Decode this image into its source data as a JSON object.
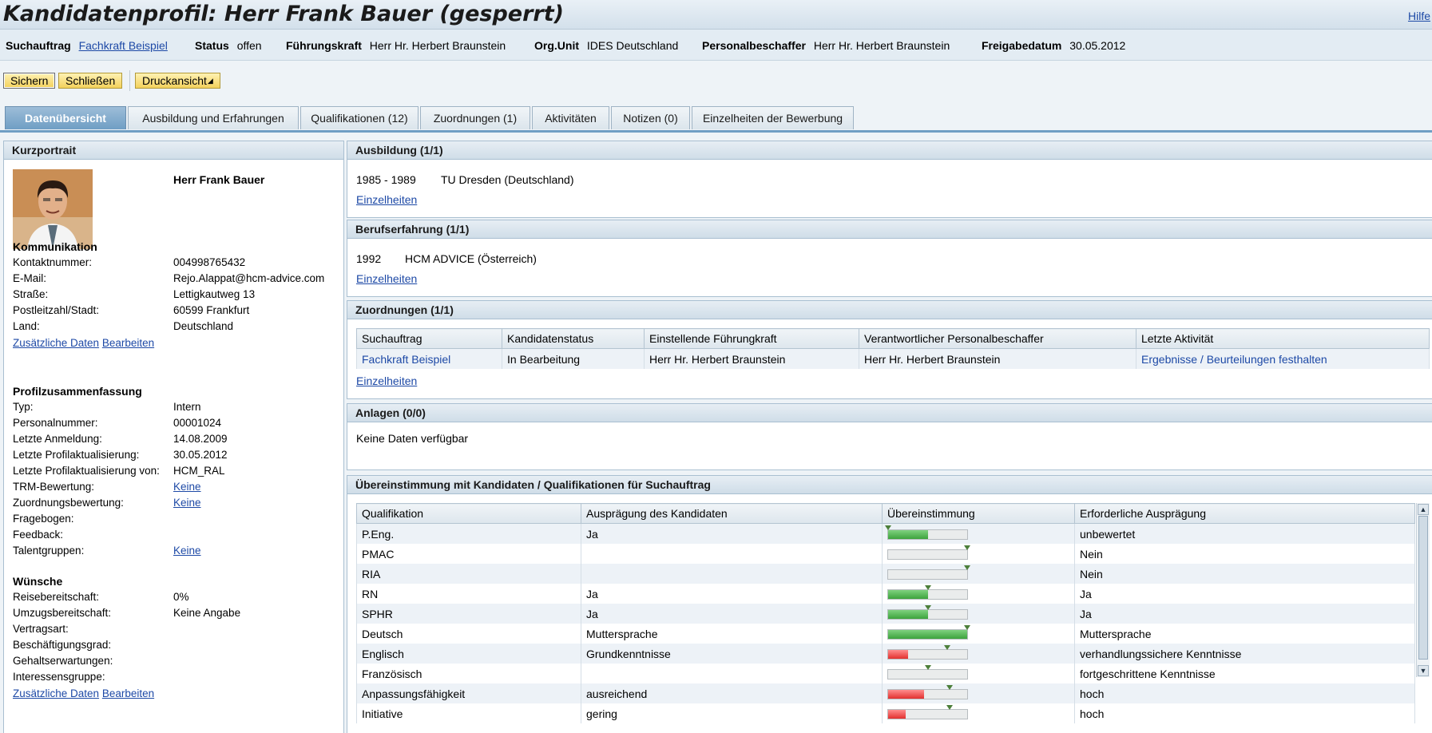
{
  "title": "Kandidatenprofil: Herr Frank Bauer (gesperrt)",
  "help_link": "Hilfe",
  "header": {
    "search_label": "Suchauftrag",
    "search_value": "Fachkraft Beispiel",
    "status_label": "Status",
    "status_value": "offen",
    "manager_label": "Führungskraft",
    "manager_value": "Herr Hr. Herbert Braunstein",
    "orgunit_label": "Org.Unit",
    "orgunit_value": "IDES Deutschland",
    "recruiter_label": "Personalbeschaffer",
    "recruiter_value": "Herr Hr. Herbert Braunstein",
    "release_label": "Freigabedatum",
    "release_value": "30.05.2012"
  },
  "toolbar": {
    "save": "Sichern",
    "close": "Schließen",
    "print": "Druckansicht"
  },
  "tabs": [
    {
      "label": "Datenübersicht",
      "active": true
    },
    {
      "label": "Ausbildung und Erfahrungen"
    },
    {
      "label": "Qualifikationen (12)"
    },
    {
      "label": "Zuordnungen (1)"
    },
    {
      "label": "Aktivitäten"
    },
    {
      "label": "Notizen (0)"
    },
    {
      "label": "Einzelheiten der Bewerbung"
    }
  ],
  "portrait": {
    "heading": "Kurzportrait",
    "name": "Herr Frank Bauer",
    "communication": {
      "heading": "Kommunikation",
      "rows": [
        {
          "label": "Kontaktnummer:",
          "value": "004998765432"
        },
        {
          "label": "E-Mail:",
          "value": "Rejo.Alappat@hcm-advice.com"
        },
        {
          "label": "Straße:",
          "value": "Lettigkautweg 13"
        },
        {
          "label": "Postleitzahl/Stadt:",
          "value": "60599 Frankfurt"
        },
        {
          "label": "Land:",
          "value": "Deutschland"
        }
      ],
      "link_additional": "Zusätzliche Daten",
      "link_edit": "Bearbeiten"
    },
    "profile": {
      "heading": "Profilzusammenfassung",
      "rows": [
        {
          "label": "Typ:",
          "value": "Intern"
        },
        {
          "label": "Personalnummer:",
          "value": "00001024"
        },
        {
          "label": "Letzte Anmeldung:",
          "value": "14.08.2009"
        },
        {
          "label": "Letzte Profilaktualisierung:",
          "value": "30.05.2012"
        },
        {
          "label": "Letzte Profilaktualisierung von:",
          "value": "HCM_RAL"
        },
        {
          "label": "TRM-Bewertung:",
          "value": "Keine"
        },
        {
          "label": "Zuordnungsbewertung:",
          "value": "Keine"
        },
        {
          "label": "Fragebogen:",
          "value": ""
        },
        {
          "label": "Feedback:",
          "value": ""
        },
        {
          "label": "Talentgruppen:",
          "value": "Keine"
        }
      ]
    },
    "wishes": {
      "heading": "Wünsche",
      "rows": [
        {
          "label": "Reisebereitschaft:",
          "value": "0%"
        },
        {
          "label": "Umzugsbereitschaft:",
          "value": "Keine Angabe"
        },
        {
          "label": "Vertragsart:",
          "value": ""
        },
        {
          "label": "Beschäftigungsgrad:",
          "value": ""
        },
        {
          "label": "Gehaltserwartungen:",
          "value": ""
        },
        {
          "label": "Interessensgruppe:",
          "value": ""
        }
      ],
      "link_additional": "Zusätzliche Daten",
      "link_edit": "Bearbeiten"
    }
  },
  "education": {
    "heading": "Ausbildung (1/1)",
    "period": "1985 - 1989",
    "institution": "TU Dresden (Deutschland)",
    "link": "Einzelheiten"
  },
  "experience": {
    "heading": "Berufserfahrung (1/1)",
    "year": "1992",
    "company": "HCM ADVICE (Österreich)",
    "link": "Einzelheiten"
  },
  "assignments": {
    "heading": "Zuordnungen (1/1)",
    "columns": [
      "Suchauftrag",
      "Kandidatenstatus",
      "Einstellende Führungkraft",
      "Verantwortlicher Personalbeschaffer",
      "Letzte Aktivität"
    ],
    "row": [
      "Fachkraft Beispiel",
      "In Bearbeitung",
      "Herr Hr. Herbert Braunstein",
      "Herr Hr. Herbert Braunstein",
      "Ergebnisse / Beurteilungen festhalten"
    ],
    "link": "Einzelheiten"
  },
  "attachments": {
    "heading": "Anlagen (0/0)",
    "empty": "Keine Daten verfügbar"
  },
  "matching": {
    "heading": "Übereinstimmung mit Kandidaten / Qualifikationen für Suchauftrag",
    "columns": [
      "Qualifikation",
      "Ausprägung des Kandidaten",
      "Übereinstimmung",
      "Erforderliche Ausprägung"
    ],
    "rows": [
      {
        "q": "P.Eng.",
        "cand": "Ja",
        "fill": 0.5,
        "color": "g",
        "target": 0.0,
        "req": "unbewertet"
      },
      {
        "q": "PMAC",
        "cand": "",
        "fill": 0,
        "color": "g",
        "target": 1.0,
        "req": "Nein"
      },
      {
        "q": "RIA",
        "cand": "",
        "fill": 0,
        "color": "g",
        "target": 1.0,
        "req": "Nein"
      },
      {
        "q": "RN",
        "cand": "Ja",
        "fill": 0.5,
        "color": "g",
        "target": 0.5,
        "req": "Ja"
      },
      {
        "q": "SPHR",
        "cand": "Ja",
        "fill": 0.5,
        "color": "g",
        "target": 0.5,
        "req": "Ja"
      },
      {
        "q": "Deutsch",
        "cand": "Muttersprache",
        "fill": 1.0,
        "color": "g",
        "target": 1.0,
        "req": "Muttersprache"
      },
      {
        "q": "Englisch",
        "cand": "Grundkenntnisse",
        "fill": 0.25,
        "color": "r",
        "target": 0.75,
        "req": "verhandlungssichere Kenntnisse"
      },
      {
        "q": "Französisch",
        "cand": "",
        "fill": 0,
        "color": "r",
        "target": 0.5,
        "req": "fortgeschrittene Kenntnisse"
      },
      {
        "q": "Anpassungsfähigkeit",
        "cand": "ausreichend",
        "fill": 0.45,
        "color": "r",
        "target": 0.78,
        "req": "hoch"
      },
      {
        "q": "Initiative",
        "cand": "gering",
        "fill": 0.22,
        "color": "r",
        "target": 0.78,
        "req": "hoch"
      }
    ]
  }
}
